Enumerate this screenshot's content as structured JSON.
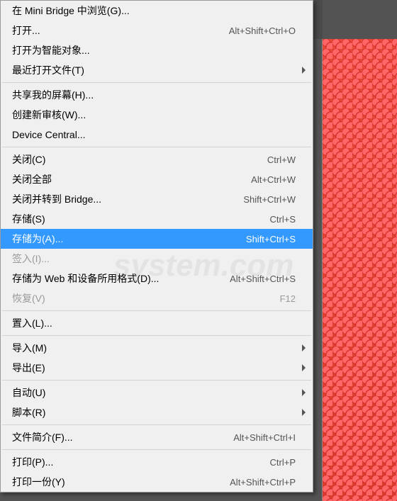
{
  "menu": {
    "browseMiniBridge": "在 Mini Bridge 中浏览(G)...",
    "open": "打开...",
    "openSc": "Alt+Shift+Ctrl+O",
    "openSmart": "打开为智能对象...",
    "recent": "最近打开文件(T)",
    "shareScreen": "共享我的屏幕(H)...",
    "newReview": "创建新审核(W)...",
    "deviceCentral": "Device Central...",
    "close": "关闭(C)",
    "closeSc": "Ctrl+W",
    "closeAll": "关闭全部",
    "closeAllSc": "Alt+Ctrl+W",
    "closeBridge": "关闭并转到 Bridge...",
    "closeBridgeSc": "Shift+Ctrl+W",
    "save": "存储(S)",
    "saveSc": "Ctrl+S",
    "saveAs": "存储为(A)...",
    "saveAsSc": "Shift+Ctrl+S",
    "checkIn": "签入(I)...",
    "saveWeb": "存储为 Web 和设备所用格式(D)...",
    "saveWebSc": "Alt+Shift+Ctrl+S",
    "revert": "恢复(V)",
    "revertSc": "F12",
    "place": "置入(L)...",
    "import": "导入(M)",
    "export": "导出(E)",
    "auto": "自动(U)",
    "script": "脚本(R)",
    "fileInfo": "文件简介(F)...",
    "fileInfoSc": "Alt+Shift+Ctrl+I",
    "print": "打印(P)...",
    "printSc": "Ctrl+P",
    "printOne": "打印一份(Y)",
    "printOneSc": "Alt+Shift+Ctrl+P"
  },
  "watermark": "system.com"
}
